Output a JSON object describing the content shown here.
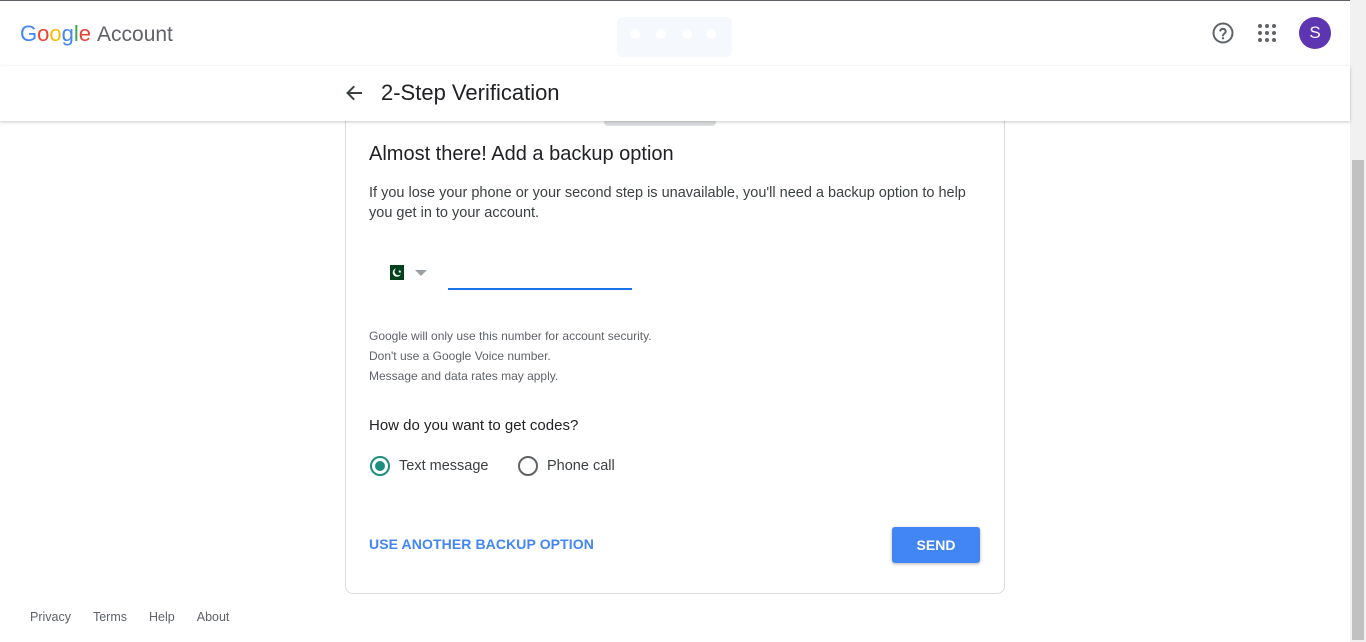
{
  "header": {
    "logo_letters": [
      "G",
      "o",
      "o",
      "g",
      "l",
      "e"
    ],
    "logo_colors": [
      "#4285f4",
      "#ea4335",
      "#fbbc05",
      "#4285f4",
      "#34a853",
      "#ea4335"
    ],
    "product": "Account",
    "help_icon": "help-circle-icon",
    "apps_icon": "apps-grid-icon",
    "avatar_initial": "S",
    "avatar_color": "#5e35b1"
  },
  "subheader": {
    "back_icon": "arrow-back-icon",
    "title": "2-Step Verification"
  },
  "card": {
    "title": "Almost there! Add a backup option",
    "description": "If you lose your phone or your second step is unavailable, you'll need a backup option to help you get in to your account.",
    "country_flag": "pakistan-flag",
    "phone_value": "",
    "notes": [
      "Google will only use this number for account security.",
      "Don't use a Google Voice number.",
      "Message and data rates may apply."
    ],
    "question": "How do you want to get codes?",
    "options": [
      {
        "label": "Text message",
        "selected": true
      },
      {
        "label": "Phone call",
        "selected": false
      }
    ],
    "alt_link": "USE ANOTHER BACKUP OPTION",
    "send_label": "SEND",
    "accent_color": "#4285f4",
    "radio_color": "#1e8e7e"
  },
  "footer": {
    "links": [
      "Privacy",
      "Terms",
      "Help",
      "About"
    ]
  }
}
